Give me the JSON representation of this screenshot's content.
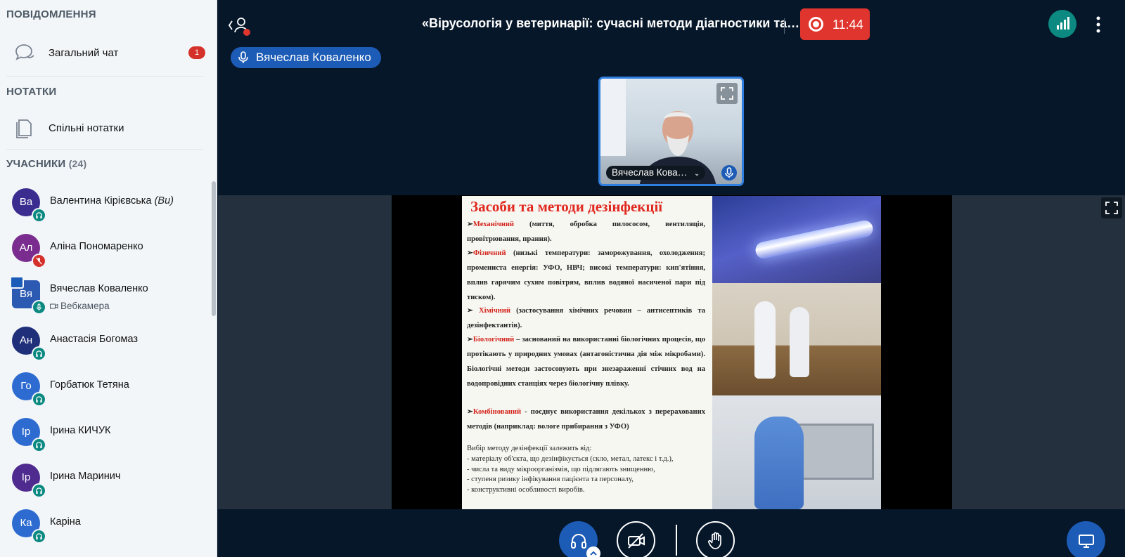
{
  "sidebar": {
    "messages_title": "ПОВІДОМЛЕННЯ",
    "public_chat": {
      "label": "Загальний чат",
      "unread": "1"
    },
    "notes_title": "НОТАТКИ",
    "shared_notes": {
      "label": "Спільні нотатки"
    },
    "participants_title": "УЧАСНИКИ",
    "participants_count": "(24)",
    "users": [
      {
        "initials": "Ва",
        "name": "Валентина Кірієвська",
        "you_tag": "(Ви)",
        "color": "#3b2d8f",
        "status": "listen"
      },
      {
        "initials": "Ал",
        "name": "Аліна Пономаренко",
        "color": "#7a2c8f",
        "status": "muted"
      },
      {
        "initials": "Вя",
        "name": "Вячеслав Коваленко",
        "sub": "Вебкамера",
        "color": "#2c5ab2",
        "status": "mic",
        "presenter": true
      },
      {
        "initials": "Ан",
        "name": "Анастасія Богомаз",
        "color": "#1f2f7a",
        "status": "listen"
      },
      {
        "initials": "Го",
        "name": "Горбатюк Тетяна",
        "color": "#2d6bd0",
        "status": "listen"
      },
      {
        "initials": "Ір",
        "name": "Ірина КИЧУК",
        "color": "#2d6bd0",
        "status": "listen"
      },
      {
        "initials": "Ір",
        "name": "Ірина Маринич",
        "color": "#4f2a8f",
        "status": "listen"
      },
      {
        "initials": "Ка",
        "name": "Каріна",
        "color": "#2d6bd0",
        "status": "listen"
      }
    ]
  },
  "header": {
    "meeting_title": "«Вірусологія у ветеринарії: сучасні методи діагностики та…",
    "record_time": "11:44",
    "talking": "Вячеслав Коваленко"
  },
  "webcam": {
    "name": "Вячеслав Кова…"
  },
  "slide": {
    "title": "Засоби та методи дезінфекції",
    "p1_term": "Механічний",
    "p1_text": " (миття, обробка пилососом, вентиляція, провітрювання, прання).",
    "p2_term": "Фізичний",
    "p2_text": " (низькі температури: заморожування, охолодження; промениста енергія: УФО, НВЧ; високі температури: кип'ятіння, вплив гарячим сухим повітрям, вплив водяної насиченої пари під тиском).",
    "p3_term": "Хімічний",
    "p3_text": " (застосування хімічних речовин – антисептиків та дезінфектантів).",
    "p4_term": "Біологічний",
    "p4_text": " – заснований на використанні біологічних процесів, що протікають у природних умовах (антагоністична дія між мікробами). Біологічні методи застосовують при знезараженні стічних вод на водопровідних станціях через біологічну плівку.",
    "p5_term": "Комбінований",
    "p5_text": " - поєднує використання декількох з перерахованих методів (наприклад: вологе прибирання з УФО)",
    "small_lines": [
      "Вибір методу дезінфекції залежить від:",
      "- матеріалу об'єкта, що дезінфікується (скло, метал, латекс і т.д.),",
      "- числа та виду мікроорганізмів, що підлягають знищенню,",
      "- ступеня ризику інфікування пацієнта та персоналу,",
      "- конструктивні особливості виробів."
    ]
  },
  "icons": {
    "back": "chevron-left-user-icon",
    "record": "record-icon",
    "connection": "signal-bars-icon",
    "more": "kebab-menu-icon",
    "audio": "headphones-icon",
    "video": "video-off-icon",
    "hand": "raise-hand-icon",
    "screen": "screen-share-icon"
  },
  "colors": {
    "accent": "#1d5cb6",
    "record": "#e0352e",
    "listen": "#0c8a82",
    "bg": "#06172a"
  }
}
